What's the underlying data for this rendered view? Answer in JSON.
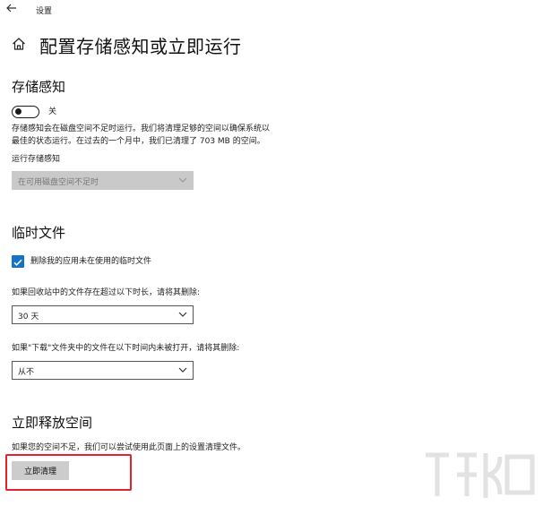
{
  "titlebar": {
    "back_icon": "back-arrow-icon",
    "title": "设置"
  },
  "page": {
    "home_icon": "home-icon",
    "title": "配置存储感知或立即运行"
  },
  "storage_sense": {
    "heading": "存储感知",
    "toggle": {
      "state": "off",
      "label": "关"
    },
    "description_line1": "存储感知会在磁盘空间不足时运行。我们将清理足够的空间以确保系统以",
    "description_line2": "最佳的状态运行。在过去的一个月中，我们已清理了 703 MB 的空间。",
    "run_label": "运行存储感知",
    "run_value": "在可用磁盘空间不足时",
    "run_disabled": true
  },
  "temp_files": {
    "heading": "临时文件",
    "checkbox": {
      "checked": true,
      "label": "删除我的应用未在使用的临时文件"
    },
    "recycle_label": "如果回收站中的文件存在超过以下时长，请将其删除:",
    "recycle_value": "30 天",
    "downloads_label": "如果\"下载\"文件夹中的文件在以下时间内未被打开，请将其删除:",
    "downloads_value": "从不"
  },
  "free_now": {
    "heading": "立即释放空间",
    "description": "如果您的空间不足，我们可以尝试使用此页面上的设置清理文件。",
    "button_label": "立即清理",
    "highlight_color": "#e5222b"
  },
  "colors": {
    "accent": "#1572c6",
    "disabled_bg": "#c9c9c9"
  }
}
